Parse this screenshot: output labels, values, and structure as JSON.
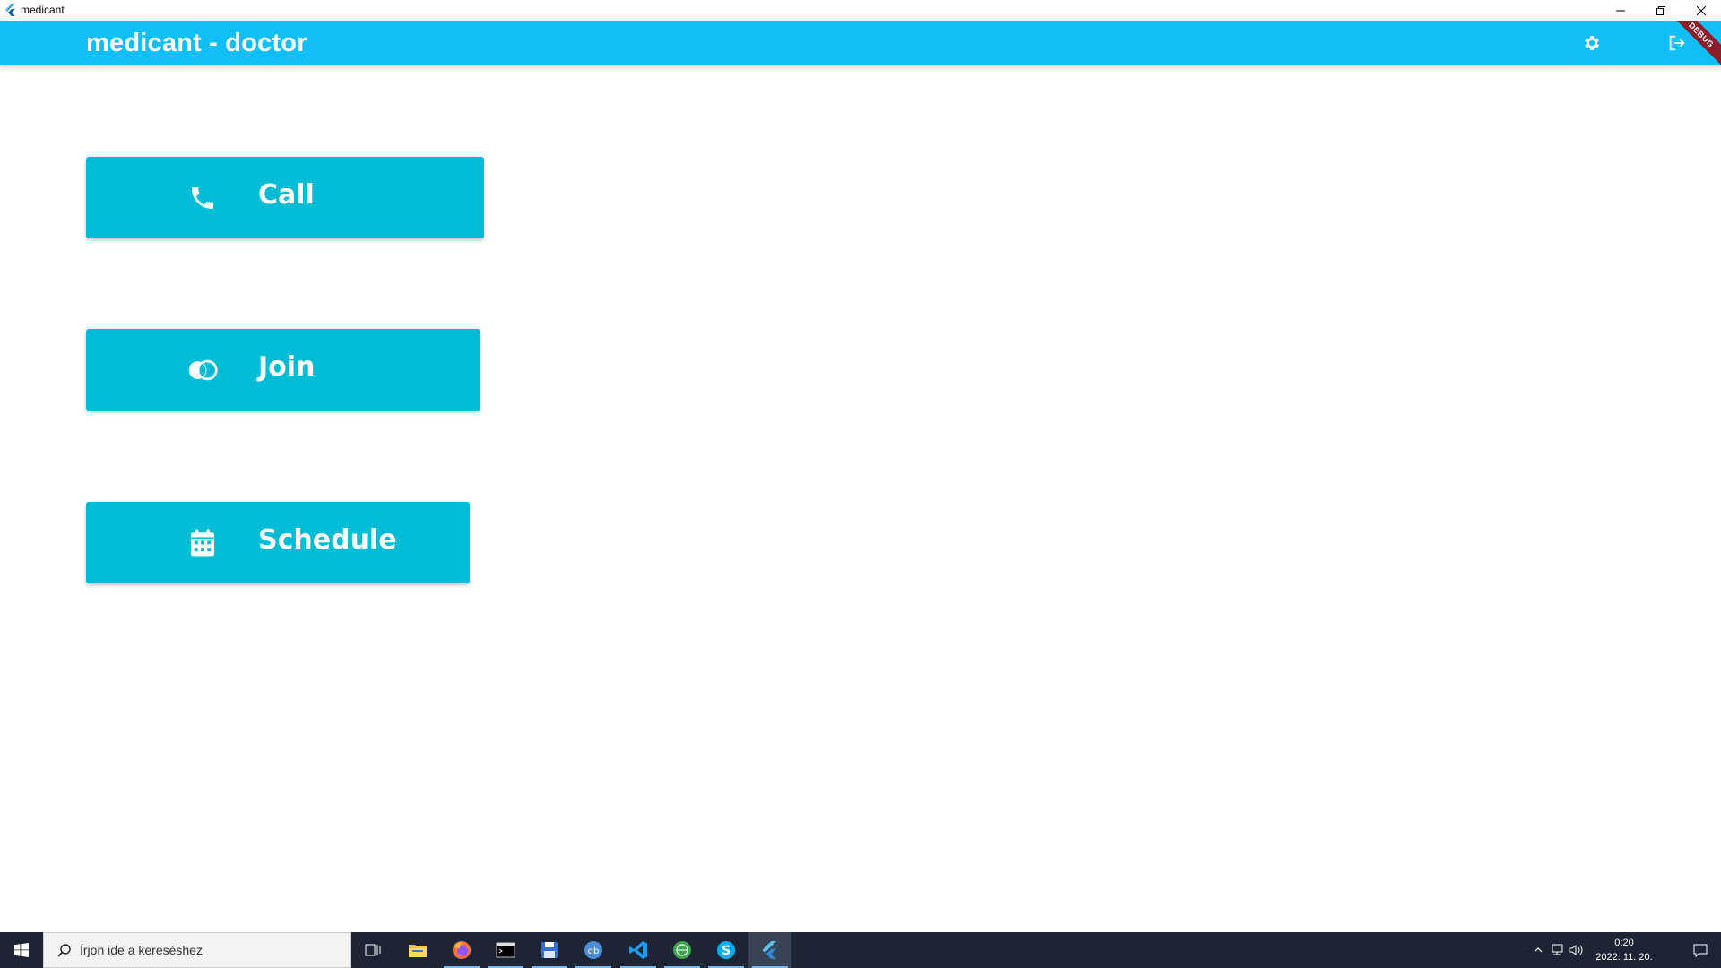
{
  "window": {
    "title": "medicant"
  },
  "appbar": {
    "title": "medicant - doctor",
    "debug_label": "DEBUG"
  },
  "buttons": {
    "call": {
      "label": "Call",
      "icon": "phone-icon"
    },
    "join": {
      "label": "Join",
      "icon": "join-icon"
    },
    "schedule": {
      "label": "Schedule",
      "icon": "calendar-icon"
    }
  },
  "taskbar": {
    "search_placeholder": "Írjon ide a kereséshez",
    "clock_time": "0:20",
    "clock_date": "2022. 11. 20."
  },
  "colors": {
    "appbar": "#10BEF8",
    "button": "#00BCD4",
    "taskbar": "#1D2433",
    "debug_ribbon": "#8E1D2A"
  }
}
